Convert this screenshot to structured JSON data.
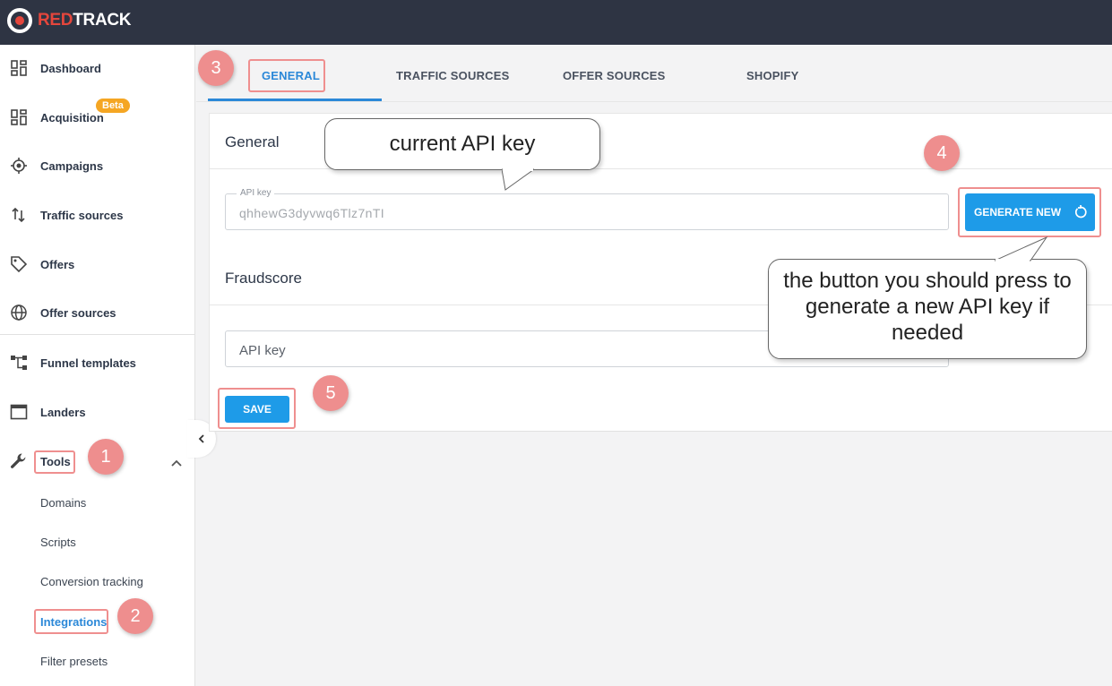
{
  "brand": {
    "name_red": "RED",
    "name_white": "TRACK"
  },
  "sidebar": {
    "items": [
      {
        "label": "Dashboard",
        "icon": "dashboard-icon"
      },
      {
        "label": "Acquisition",
        "icon": "dashboard-icon",
        "badge": "Beta"
      },
      {
        "label": "Campaigns",
        "icon": "target-icon"
      },
      {
        "label": "Traffic sources",
        "icon": "arrows-updown-icon"
      },
      {
        "label": "Offers",
        "icon": "tag-icon"
      },
      {
        "label": "Offer sources",
        "icon": "globe-icon"
      },
      {
        "label": "Funnel templates",
        "icon": "funnel-icon"
      },
      {
        "label": "Landers",
        "icon": "window-icon"
      },
      {
        "label": "Tools",
        "icon": "wrench-icon"
      }
    ],
    "tools_sub": [
      "Domains",
      "Scripts",
      "Conversion tracking",
      "Integrations",
      "Filter presets"
    ]
  },
  "tabs": [
    "GENERAL",
    "TRAFFIC SOURCES",
    "OFFER SOURCES",
    "SHOPIFY"
  ],
  "general": {
    "title": "General",
    "api_key_legend": "API key",
    "api_key_value": "qhhewG3dyvwq6Tlz7nTI",
    "generate_label": "GENERATE NEW"
  },
  "fraudscore": {
    "title": "Fraudscore",
    "api_key_placeholder": "API key"
  },
  "save_label": "SAVE",
  "annotations": {
    "steps": [
      "1",
      "2",
      "3",
      "4",
      "5"
    ],
    "bubble_current": "current API key",
    "bubble_button": "the button you should press to generate a new API key if needed"
  },
  "colors": {
    "accent": "#1e9be8",
    "topbar": "#2e3443",
    "brand_red": "#e5463c",
    "highlight": "#ef8f8f"
  }
}
